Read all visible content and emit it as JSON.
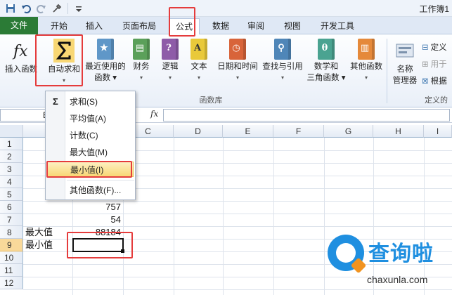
{
  "window": {
    "title": "工作簿1"
  },
  "qat": {
    "icons": [
      "save-icon",
      "undo-icon",
      "redo-icon",
      "tool-icon",
      "customize-icon"
    ]
  },
  "tabs": {
    "file": "文件",
    "items": [
      "开始",
      "插入",
      "页面布局",
      "公式",
      "数据",
      "审阅",
      "视图",
      "开发工具"
    ],
    "active": "公式"
  },
  "ribbon": {
    "insert_function": "插入函数",
    "autosum": "自动求和",
    "autosum_drop": "▾",
    "recent": "最近使用的",
    "recent_line2": "函数 ▾",
    "financial": "财务",
    "logical": "逻辑",
    "text": "文本",
    "datetime": "日期和时间",
    "lookup": "查找与引用",
    "math": "数学和",
    "math_line2": "三角函数 ▾",
    "other": "其他函数",
    "group_label": "函数库",
    "name_manager": "名称",
    "name_manager_line2": "管理器",
    "define": "定义",
    "use_in": "用于",
    "create": "根据",
    "defined_group_label": "定义的",
    "drop_mark": "▾"
  },
  "formula_bar": {
    "fx": "fx",
    "name_fragment": "E"
  },
  "grid": {
    "columns": [
      "C",
      "D",
      "E",
      "F",
      "G",
      "H",
      "I"
    ],
    "rows": [
      "1",
      "2",
      "3",
      "4",
      "5",
      "6",
      "7",
      "8",
      "9",
      "10",
      "11",
      "12"
    ],
    "active_row": "9",
    "cells": {
      "b6": "757",
      "b7": "54",
      "a8": "最大值",
      "b8": "88184",
      "a9": "最小值"
    }
  },
  "autosum_menu": {
    "items": [
      "求和(S)",
      "平均值(A)",
      "计数(C)",
      "最大值(M)",
      "最小值(I)",
      "其他函数(F)..."
    ],
    "hover_item": "最小值(I)",
    "sigma": "Σ"
  },
  "watermark": {
    "text": "查询啦",
    "url": "chaxunla.com"
  },
  "colors": {
    "file_tab": "#2b7b36",
    "highlight": "#e53c3c",
    "hover_fill": "#f8d774",
    "watermark_blue": "#1f8fe0",
    "watermark_orange": "#f19320"
  }
}
